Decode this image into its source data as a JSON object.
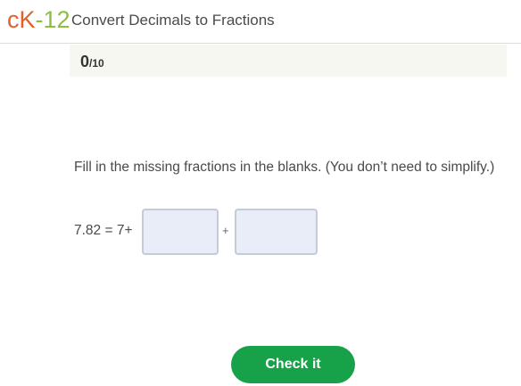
{
  "header": {
    "logo": {
      "c": "c",
      "k": "K",
      "dash": "-",
      "num": "12"
    },
    "title": "Convert Decimals to Fractions"
  },
  "score": {
    "current": "0",
    "total": "/10"
  },
  "question": {
    "prompt": "Fill in the missing fractions in the blanks. (You don’t need to simplify.)",
    "equation_prefix": "7.82 = 7+",
    "operator": "+",
    "blank1_value": "",
    "blank2_value": ""
  },
  "actions": {
    "check_label": "Check it"
  },
  "colors": {
    "logo_orange": "#e0622a",
    "logo_green": "#8bbf3f",
    "button_green": "#17a24a",
    "input_bg": "#e8edf7"
  }
}
